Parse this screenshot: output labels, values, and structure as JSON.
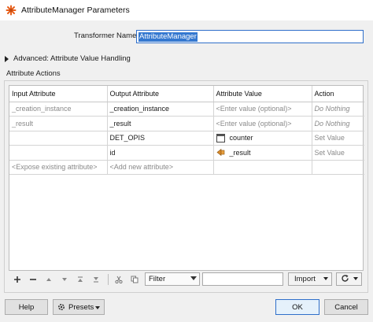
{
  "window": {
    "title": "AttributeManager Parameters"
  },
  "transformer": {
    "label": "Transformer Name:",
    "value": "AttributeManager"
  },
  "advanced": {
    "label": "Advanced: Attribute Value Handling"
  },
  "section": {
    "title": "Attribute Actions"
  },
  "table": {
    "headers": {
      "input": "Input Attribute",
      "output": "Output Attribute",
      "value": "Attribute Value",
      "action": "Action"
    },
    "rows": [
      {
        "input": "_creation_instance",
        "output": "_creation_instance",
        "value": "<Enter value (optional)>",
        "action": "Do Nothing"
      },
      {
        "input": "_result",
        "output": "_result",
        "value": "<Enter value (optional)>",
        "action": "Do Nothing"
      },
      {
        "input": "",
        "output": "DET_OPIS",
        "value": "counter",
        "value_icon": "counter-function-icon",
        "action": "Set Value"
      },
      {
        "input": "",
        "output": "id",
        "value": "_result",
        "value_icon": "attribute-value-icon",
        "action": "Set Value"
      },
      {
        "input": "<Expose existing attribute>",
        "output": "<Add new attribute>",
        "value": "",
        "action": ""
      }
    ]
  },
  "toolbar": {
    "icons": [
      "add-icon",
      "remove-icon",
      "move-up-icon",
      "move-down-icon",
      "move-top-icon",
      "move-bottom-icon",
      "cut-icon",
      "copy-icon",
      "paste-icon",
      "refresh-icon"
    ],
    "filter_label": "Filter",
    "filter_text": "",
    "import_label": "Import"
  },
  "buttons": {
    "help": "Help",
    "presets": "Presets",
    "ok": "OK",
    "cancel": "Cancel"
  },
  "colors": {
    "accent": "#3478d0",
    "ok_border": "#2f6fca",
    "panel": "#f0f0f0",
    "placeholder": "#8a8a8a",
    "app_icon": "#e8601c"
  }
}
